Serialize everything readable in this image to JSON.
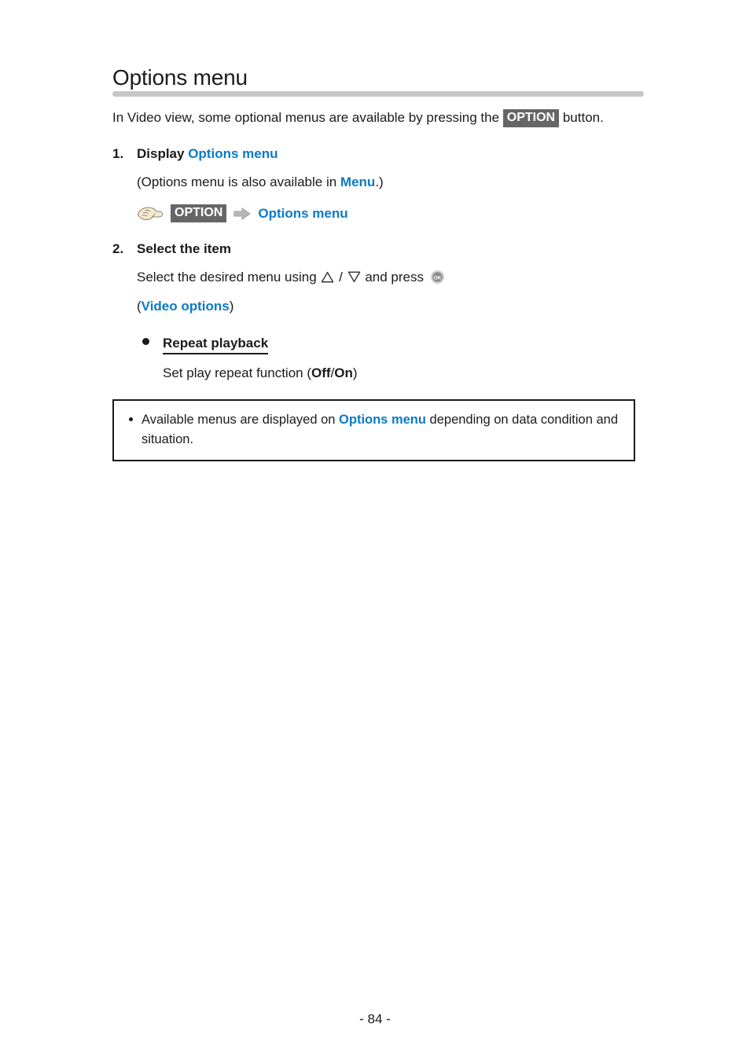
{
  "document": {
    "title": "Options menu",
    "page_number": "- 84 -"
  },
  "intro": {
    "text_before": "In Video view, some optional menus are available by pressing the ",
    "keycap": "OPTION",
    "text_after": " button."
  },
  "steps": [
    {
      "number": "1.",
      "heading_prefix": "Display ",
      "heading_link": "Options menu",
      "note_before": "(Options menu is also available in ",
      "note_link": "Menu",
      "note_after": ".)",
      "operation": {
        "hand_icon": "pointing-hand-icon",
        "keycap": "OPTION",
        "arrow_icon": "right-arrow-icon",
        "target": "Options menu"
      }
    },
    {
      "number": "2.",
      "heading": "Select the item",
      "instruction_before": "Select the desired menu using ",
      "up_icon": "triangle-up-icon",
      "separator": " / ",
      "down_icon": "triangle-down-icon",
      "instruction_middle": " and press ",
      "ok_icon": "ok-button-icon",
      "group_open": "(",
      "group_link": "Video options",
      "group_close": ")",
      "options": [
        {
          "title": "Repeat playback",
          "description_before": "Set play repeat function (",
          "value_off": "Off",
          "value_sep": "/",
          "value_on": "On",
          "description_after": ")"
        }
      ]
    }
  ],
  "note": {
    "text_before": "Available menus are displayed on ",
    "link": "Options menu",
    "text_after": " depending on data condition and situation."
  },
  "colors": {
    "link_blue": "#0b7ac6",
    "keycap_bg": "#666666",
    "rule_gray": "#c6c6c6",
    "text": "#1b1b1b"
  }
}
